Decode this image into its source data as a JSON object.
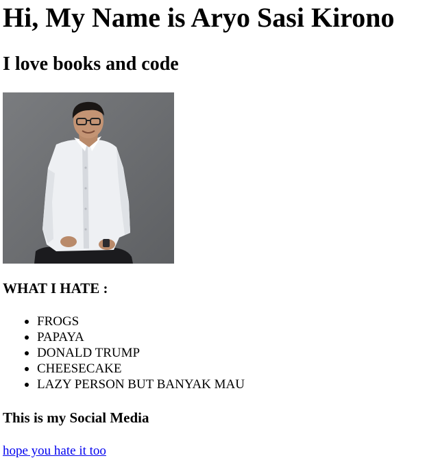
{
  "header": {
    "title": "Hi, My Name is Aryo Sasi Kirono",
    "subtitle": "I love books and code"
  },
  "profile_photo": {
    "alt": "Aryo Sasi Kirono"
  },
  "hate_section": {
    "heading": "WHAT I HATE :",
    "items": [
      "FROGS",
      "PAPAYA",
      "DONALD TRUMP",
      "CHEESECAKE",
      "LAZY PERSON BUT BANYAK MAU"
    ]
  },
  "social_section": {
    "heading": "This is my Social Media",
    "link_text": "hope you hate it too",
    "link_color": "#0000ee"
  }
}
